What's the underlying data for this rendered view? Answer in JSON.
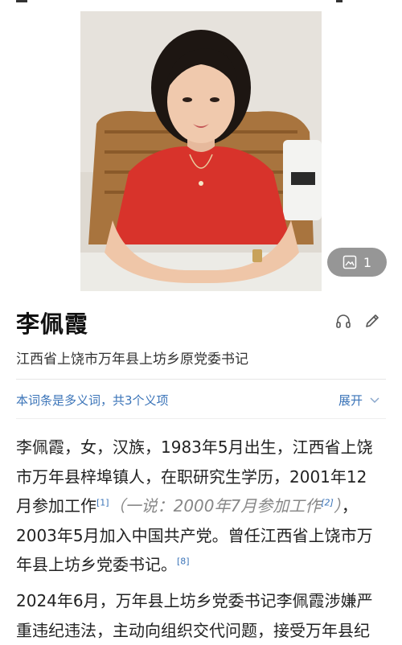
{
  "hero": {
    "gallery_count": "1",
    "gallery_icon": "image-gallery-icon"
  },
  "entry": {
    "name": "李佩霞",
    "subtitle": "江西省上饶市万年县上坊乡原党委书记",
    "actions": [
      "headphones-icon",
      "edit-pencil-icon"
    ]
  },
  "polysemy": {
    "text": "本词条是多义词，共3个义项",
    "expand_label": "展开"
  },
  "intro": {
    "line1": "李佩霞，女，汉族，1983年5月出生，江西省上饶",
    "line2": "市万年县梓埠镇人，在职研究生学历，2001年12",
    "line3_a": "月参加工作",
    "ref1": "[1]",
    "alt_text": "（一说：2000年7月参加工作",
    "ref2": "[2]",
    "alt_close": "）",
    "line3_b": "，",
    "line4": "2003年5月加入中国共产党。曾任江西省上饶市万",
    "line5": "年县上坊乡党委书记。",
    "ref8": "[8]"
  },
  "second": {
    "line1": "2024年6月，万年县上坊乡党委书记李佩霞涉嫌严",
    "line2": "重违纪违法，主动向组织交代问题，接受万年县纪"
  },
  "colors": {
    "link": "#3b74b8",
    "alt_text": "#888888",
    "dress": "#d8332b"
  }
}
